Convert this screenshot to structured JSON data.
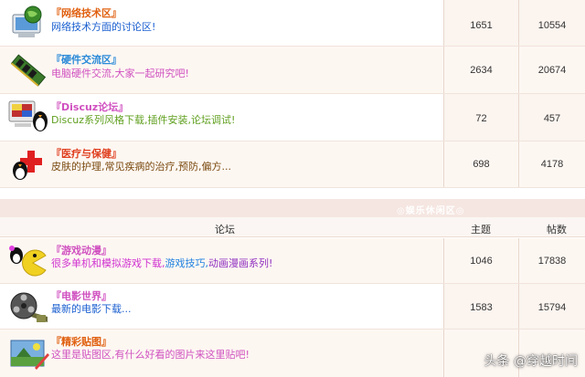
{
  "section1": {
    "forums": [
      {
        "title": "『网络技术区』",
        "title_color": "#e06010",
        "desc": "网络技术方面的讨论区!",
        "desc_color": "#1a5fd0",
        "topics": "1651",
        "posts": "10554",
        "icon": "network-computer-icon"
      },
      {
        "title": "『硬件交流区』",
        "title_color": "#2a8ad8",
        "desc": "电脑硬件交流,大家一起研究吧!",
        "desc_color": "#d050c0",
        "topics": "2634",
        "posts": "20674",
        "icon": "memory-chip-icon"
      },
      {
        "title": "『Discuz论坛』",
        "title_color": "#d050c0",
        "desc": "Discuz系列风格下载,插件安装,论坛调试!",
        "desc_color": "#60a020",
        "topics": "72",
        "posts": "457",
        "icon": "computer-penguin-icon"
      },
      {
        "title": "『医疗与保健』",
        "title_color": "#e04020",
        "desc": "皮肤的护理,常见疾病的治疗,预防,偏方...",
        "desc_color": "#7a4a10",
        "topics": "698",
        "posts": "4178",
        "icon": "penguin-medical-cross-icon"
      }
    ]
  },
  "section2": {
    "category_title": "◎娱乐休闲区◎",
    "headers": {
      "forum": "论坛",
      "topics": "主题",
      "posts": "帖数"
    },
    "forums": [
      {
        "title": "『游戏动漫』",
        "title_color": "#d050c0",
        "desc": "很多单机和模拟游戏下载,",
        "desc_color": "#d030d0",
        "desc2": "游戏技巧,",
        "desc2_color": "#2080e0",
        "desc3": "动画漫画系列!",
        "desc3_color": "#9030c0",
        "topics": "1046",
        "posts": "17838",
        "icon": "pacman-penguin-icon"
      },
      {
        "title": "『电影世界』",
        "title_color": "#d050c0",
        "desc": "最新的电影下载...",
        "desc_color": "#1a5fd0",
        "topics": "1583",
        "posts": "15794",
        "icon": "film-reel-icon"
      },
      {
        "title": "『精彩贴图』",
        "title_color": "#e06010",
        "desc": "这里是贴图区,有什么好看的图片来这里贴吧!",
        "desc_color": "#d050c0",
        "topics": "",
        "posts": "",
        "icon": "paint-picture-icon"
      }
    ]
  },
  "watermark": {
    "text": "头条 @穿越时间"
  }
}
